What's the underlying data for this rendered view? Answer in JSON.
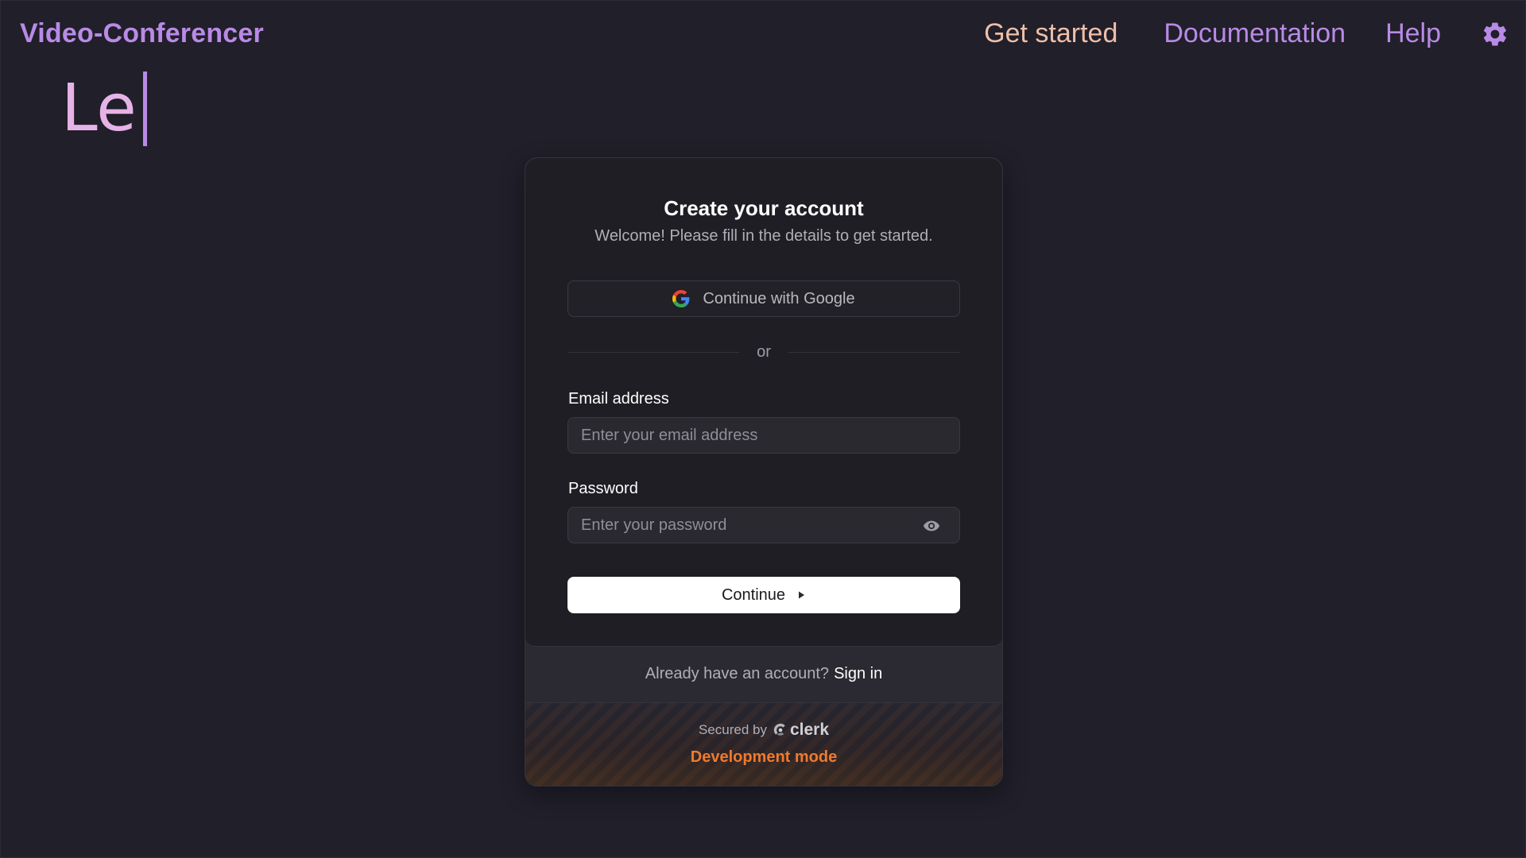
{
  "header": {
    "brand": "Video-Conferencer",
    "nav": {
      "get_started": "Get started",
      "documentation": "Documentation",
      "help": "Help"
    },
    "settings_icon": "gear-icon"
  },
  "hero": {
    "typed_text": "Le"
  },
  "card": {
    "title": "Create your account",
    "subtitle": "Welcome! Please fill in the details to get started.",
    "google_button": {
      "label": "Continue with Google",
      "icon": "google-icon"
    },
    "divider": "or",
    "email": {
      "label": "Email address",
      "placeholder": "Enter your email address",
      "value": ""
    },
    "password": {
      "label": "Password",
      "placeholder": "Enter your password",
      "value": "",
      "toggle_icon": "eye-icon"
    },
    "continue_button": {
      "label": "Continue",
      "icon": "play-icon"
    }
  },
  "signin": {
    "prompt": "Already have an account?",
    "link": "Sign in"
  },
  "footer": {
    "secured_by": "Secured by",
    "provider": "clerk",
    "mode": "Development mode"
  },
  "colors": {
    "background": "#201f2a",
    "accent": "#b98ae6",
    "get_started": "#f0bfa8",
    "dev_mode": "#ef7a2e"
  }
}
